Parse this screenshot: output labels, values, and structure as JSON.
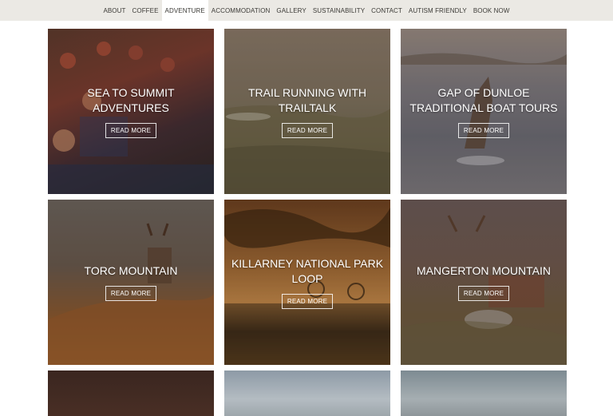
{
  "nav": {
    "items": [
      {
        "label": "ABOUT"
      },
      {
        "label": "COFFEE"
      },
      {
        "label": "ADVENTURE"
      },
      {
        "label": "ACCOMMODATION"
      },
      {
        "label": "GALLERY"
      },
      {
        "label": "SUSTAINABILITY"
      },
      {
        "label": "CONTACT"
      },
      {
        "label": "AUTISM FRIENDLY"
      },
      {
        "label": "BOOK NOW"
      }
    ],
    "active": "ADVENTURE"
  },
  "cards": [
    {
      "title": "SEA TO SUMMIT ADVENTURES",
      "button": "READ MORE"
    },
    {
      "title": "TRAIL RUNNING WITH TRAILTALK",
      "button": "READ MORE"
    },
    {
      "title": "GAP OF DUNLOE TRADITIONAL BOAT TOURS",
      "button": "READ MORE"
    },
    {
      "title": "TORC MOUNTAIN",
      "button": "READ MORE"
    },
    {
      "title": "KILLARNEY NATIONAL PARK LOOP",
      "button": "READ MORE"
    },
    {
      "title": "MANGERTON MOUNTAIN",
      "button": "READ MORE"
    }
  ]
}
